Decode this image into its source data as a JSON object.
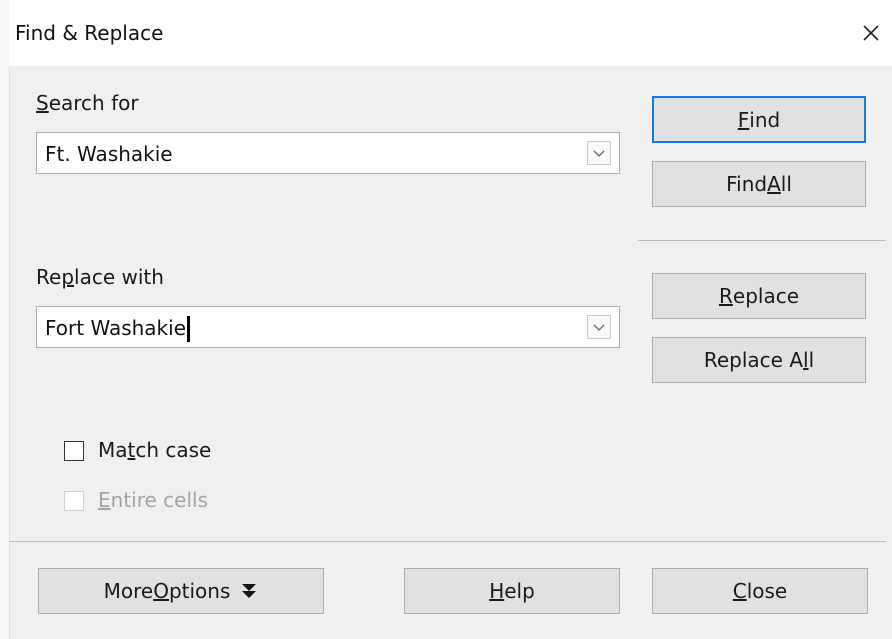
{
  "dialog": {
    "title": "Find & Replace"
  },
  "search": {
    "label_pre": "",
    "label_mnemonic": "S",
    "label_post": "earch for",
    "value": "Ft. Washakie"
  },
  "replace": {
    "label_pre": "Re",
    "label_mnemonic": "p",
    "label_post": "lace with",
    "value": "Fort Washakie"
  },
  "buttons": {
    "find": {
      "pre": "",
      "mnemonic": "F",
      "post": "ind"
    },
    "find_all": {
      "pre": "Find ",
      "mnemonic": "A",
      "post": "ll"
    },
    "replace": {
      "pre": "",
      "mnemonic": "R",
      "post": "eplace"
    },
    "replace_all": {
      "pre": "Replace A",
      "mnemonic": "l",
      "post": "l"
    },
    "more_options": {
      "pre": "More ",
      "mnemonic": "O",
      "post": "ptions"
    },
    "help": {
      "pre": "",
      "mnemonic": "H",
      "post": "elp"
    },
    "close": {
      "pre": "",
      "mnemonic": "C",
      "post": "lose"
    }
  },
  "options": {
    "match_case": {
      "pre": "Ma",
      "mnemonic": "t",
      "post": "ch case",
      "checked": false,
      "enabled": true
    },
    "entire_cells": {
      "pre": "",
      "mnemonic": "E",
      "post": "ntire cells",
      "checked": false,
      "enabled": false
    }
  },
  "colors": {
    "focus_border": "#1e78d7",
    "button_bg": "#e1e1e1",
    "window_bg": "#f0f0f0"
  },
  "icons": [
    "close-icon",
    "dropdown-chevron-icon",
    "double-chevron-down-icon"
  ]
}
